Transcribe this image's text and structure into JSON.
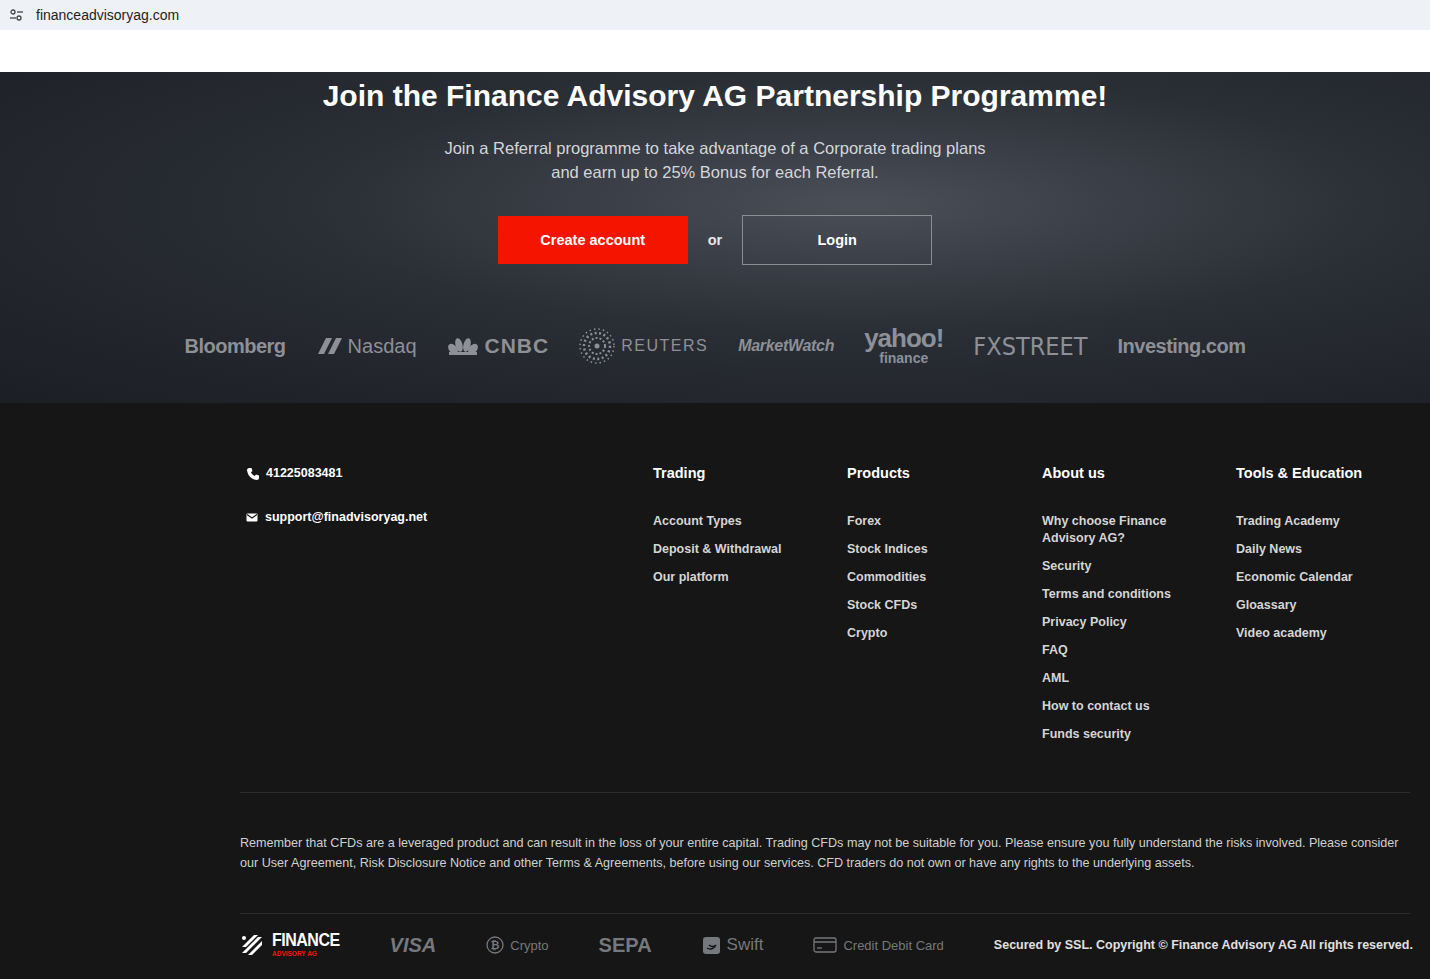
{
  "browser": {
    "url": "financeadvisoryag.com"
  },
  "hero": {
    "title": "Join the Finance Advisory AG Partnership Programme!",
    "subtitle": [
      "Join a Referral programme to take advantage of a Corporate trading plans",
      "and earn up to 25% Bonus for each Referral."
    ],
    "buttons": [
      {
        "label": "Create account",
        "kind": "primary"
      },
      {
        "label": "Login",
        "kind": "secondary"
      }
    ],
    "separator": "or",
    "media_logos": [
      {
        "name": "Bloomberg"
      },
      {
        "name": "Nasdaq"
      },
      {
        "name": "CNBC"
      },
      {
        "name": "REUTERS"
      },
      {
        "name": "MarketWatch"
      },
      {
        "name": "yahoo!",
        "sub": "finance"
      },
      {
        "name": "FXSTREET"
      },
      {
        "name": "Investing.com"
      }
    ]
  },
  "footer": {
    "contact": {
      "phone": "41225083481",
      "email": "support@finadvisoryag.net"
    },
    "columns": [
      {
        "title": "Trading",
        "links": [
          "Account Types",
          "Deposit & Withdrawal",
          "Our platform"
        ]
      },
      {
        "title": "Products",
        "links": [
          "Forex",
          "Stock Indices",
          "Commodities",
          "Stock CFDs",
          "Crypto"
        ]
      },
      {
        "title": "About us",
        "links": [
          "Why choose Finance Advisory AG?",
          "Security",
          "Terms and conditions",
          "Privacy Policy",
          "FAQ",
          "AML",
          "How to contact us",
          "Funds security"
        ]
      },
      {
        "title": "Tools & Education",
        "links": [
          "Trading Academy",
          "Daily News",
          "Economic Calendar",
          "Gloassary",
          "Video academy"
        ]
      }
    ],
    "disclaimer": "Remember that CFDs are a leveraged product and can result in the loss of your entire capital. Trading CFDs may not be suitable for you. Please ensure you fully understand the risks involved. Please consider our User Agreement, Risk Disclosure Notice and other Terms & Agreements, before using our services. CFD traders do not own or have any rights to the underlying assets.",
    "logo": {
      "title": "FINANCE",
      "subtitle": "ADVISORY AG"
    },
    "payments": [
      {
        "label": "VISA",
        "kind": "wordmark"
      },
      {
        "label": "Crypto",
        "kind": "coin"
      },
      {
        "label": "SEPA",
        "kind": "wordmark"
      },
      {
        "label": "Swift",
        "kind": "badge"
      },
      {
        "label": "Credit Debit Card",
        "kind": "card"
      }
    ],
    "copyright": "Secured by SSL. Copyright © Finance Advisory AG All rights reserved."
  }
}
